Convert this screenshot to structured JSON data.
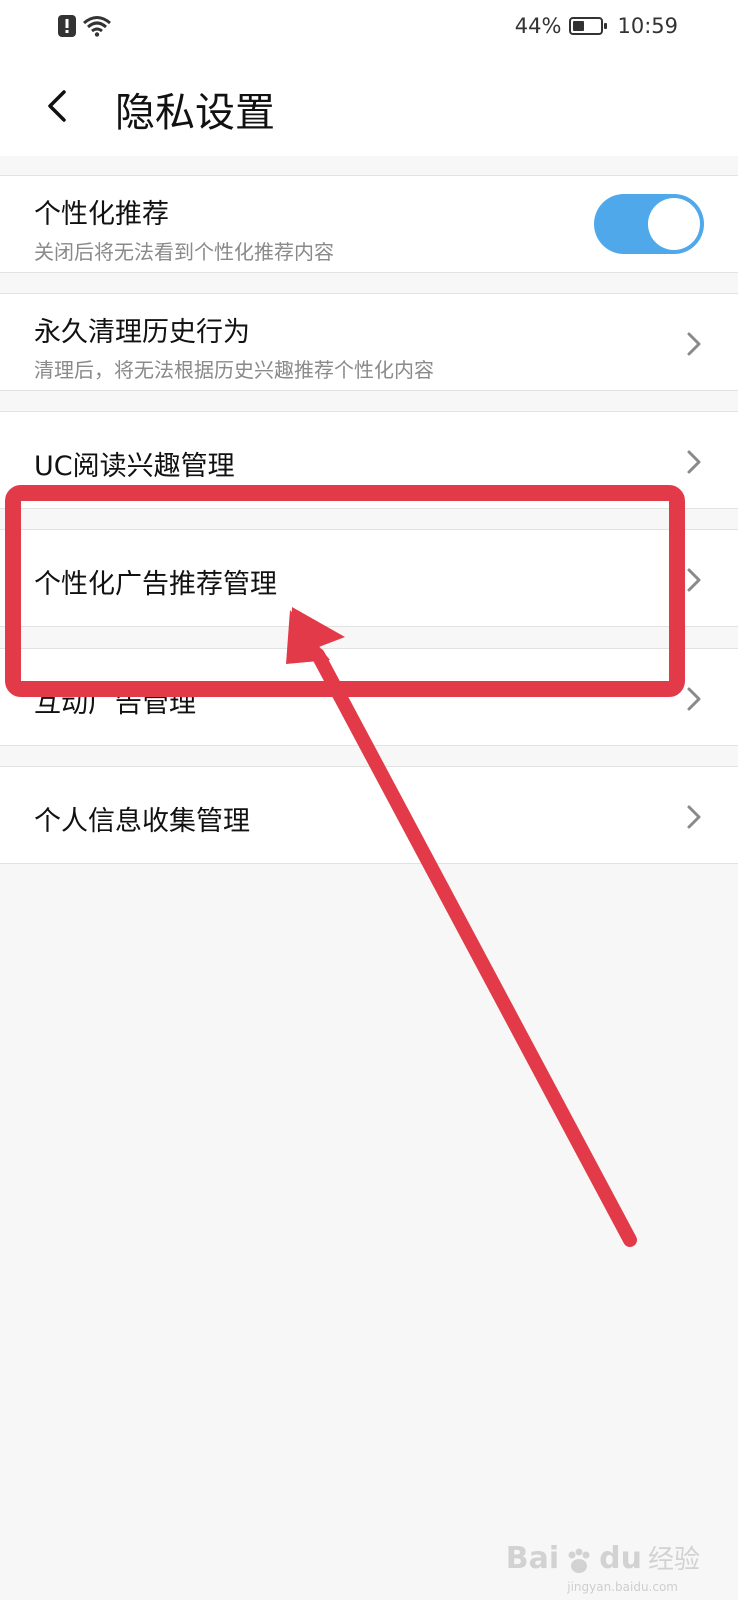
{
  "status_bar": {
    "battery_percent": "44%",
    "battery_level": 0.44,
    "time": "10:59"
  },
  "header": {
    "title": "隐私设置"
  },
  "settings": [
    {
      "title": "个性化推荐",
      "subtitle": "关闭后将无法看到个性化推荐内容",
      "control": "toggle",
      "enabled": true
    },
    {
      "title": "永久清理历史行为",
      "subtitle": "清理后，将无法根据历史兴趣推荐个性化内容",
      "control": "chevron"
    },
    {
      "title": "UC阅读兴趣管理",
      "subtitle": "",
      "control": "chevron"
    },
    {
      "title": "个性化广告推荐管理",
      "subtitle": "",
      "control": "chevron"
    },
    {
      "title": "互动广告管理",
      "subtitle": "",
      "control": "chevron"
    },
    {
      "title": "个人信息收集管理",
      "subtitle": "",
      "control": "chevron"
    }
  ],
  "colors": {
    "toggle_on": "#4ea8e9",
    "annotation_red": "#e23a48"
  },
  "watermark": {
    "brand": "Bai",
    "brand2": "du",
    "text": "经验",
    "url": "jingyan.baidu.com"
  }
}
